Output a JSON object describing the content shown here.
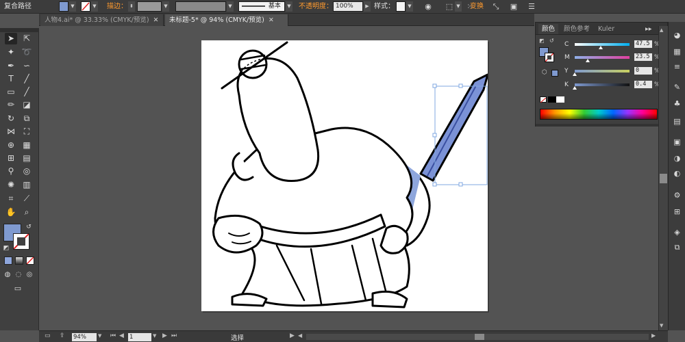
{
  "control_bar": {
    "selection_type": "复合路径",
    "fill_color": "#7f9ad0",
    "stroke_label": "描边：",
    "stroke_weight": "",
    "brush_value": "",
    "stroke_profile": "基本",
    "opacity_label": "不透明度：",
    "opacity_value": "100%",
    "style_label": "样式：",
    "transform_label": "变换"
  },
  "tabs": [
    {
      "label": "人物4.ai* @ 33.33% (CMYK/预览)",
      "active": false
    },
    {
      "label": "未标题-5* @ 94% (CMYK/预览)",
      "active": true
    }
  ],
  "tools": {
    "fill_color": "#7f9ad0"
  },
  "color_panel": {
    "tabs": [
      "颜色",
      "颜色参考",
      "Kuler"
    ],
    "channels": [
      {
        "name": "C",
        "value": "47.5",
        "percent": 47.5
      },
      {
        "name": "M",
        "value": "23.5",
        "percent": 23.5
      },
      {
        "name": "Y",
        "value": "0",
        "percent": 0
      },
      {
        "name": "K",
        "value": "0.4",
        "percent": 0.4
      }
    ],
    "percent_sign": "%",
    "current_fill": "#7f9ad0"
  },
  "status_bar": {
    "zoom": "94%",
    "artboard_number": "1",
    "tool_status": "选择"
  },
  "colors": {
    "accent": "#7f9ad0",
    "orange_label": "#ff9a2e",
    "sword_blade": "#7b92d6"
  },
  "icons": {
    "tools": [
      "selection-icon",
      "direct-selection-icon",
      "magic-wand-icon",
      "lasso-icon",
      "pen-icon",
      "curvature-icon",
      "type-icon",
      "line-icon",
      "rectangle-icon",
      "paintbrush-icon",
      "pencil-icon",
      "eraser-icon",
      "rotate-icon",
      "scale-icon",
      "width-icon",
      "free-transform-icon",
      "shape-builder-icon",
      "perspective-icon",
      "mesh-icon",
      "gradient-icon",
      "eyedropper-icon",
      "blend-icon",
      "symbol-sprayer-icon",
      "graph-icon",
      "artboard-icon",
      "slice-icon",
      "hand-icon",
      "zoom-icon"
    ],
    "dock": [
      "color-icon",
      "color-guide-icon",
      "stroke-icon",
      "brushes-icon",
      "symbols-icon",
      "graphic-styles-icon",
      "gradient-panel-icon",
      "transparency-icon",
      "appearance-icon",
      "align-icon",
      "layers-icon",
      "artboards-icon"
    ]
  }
}
